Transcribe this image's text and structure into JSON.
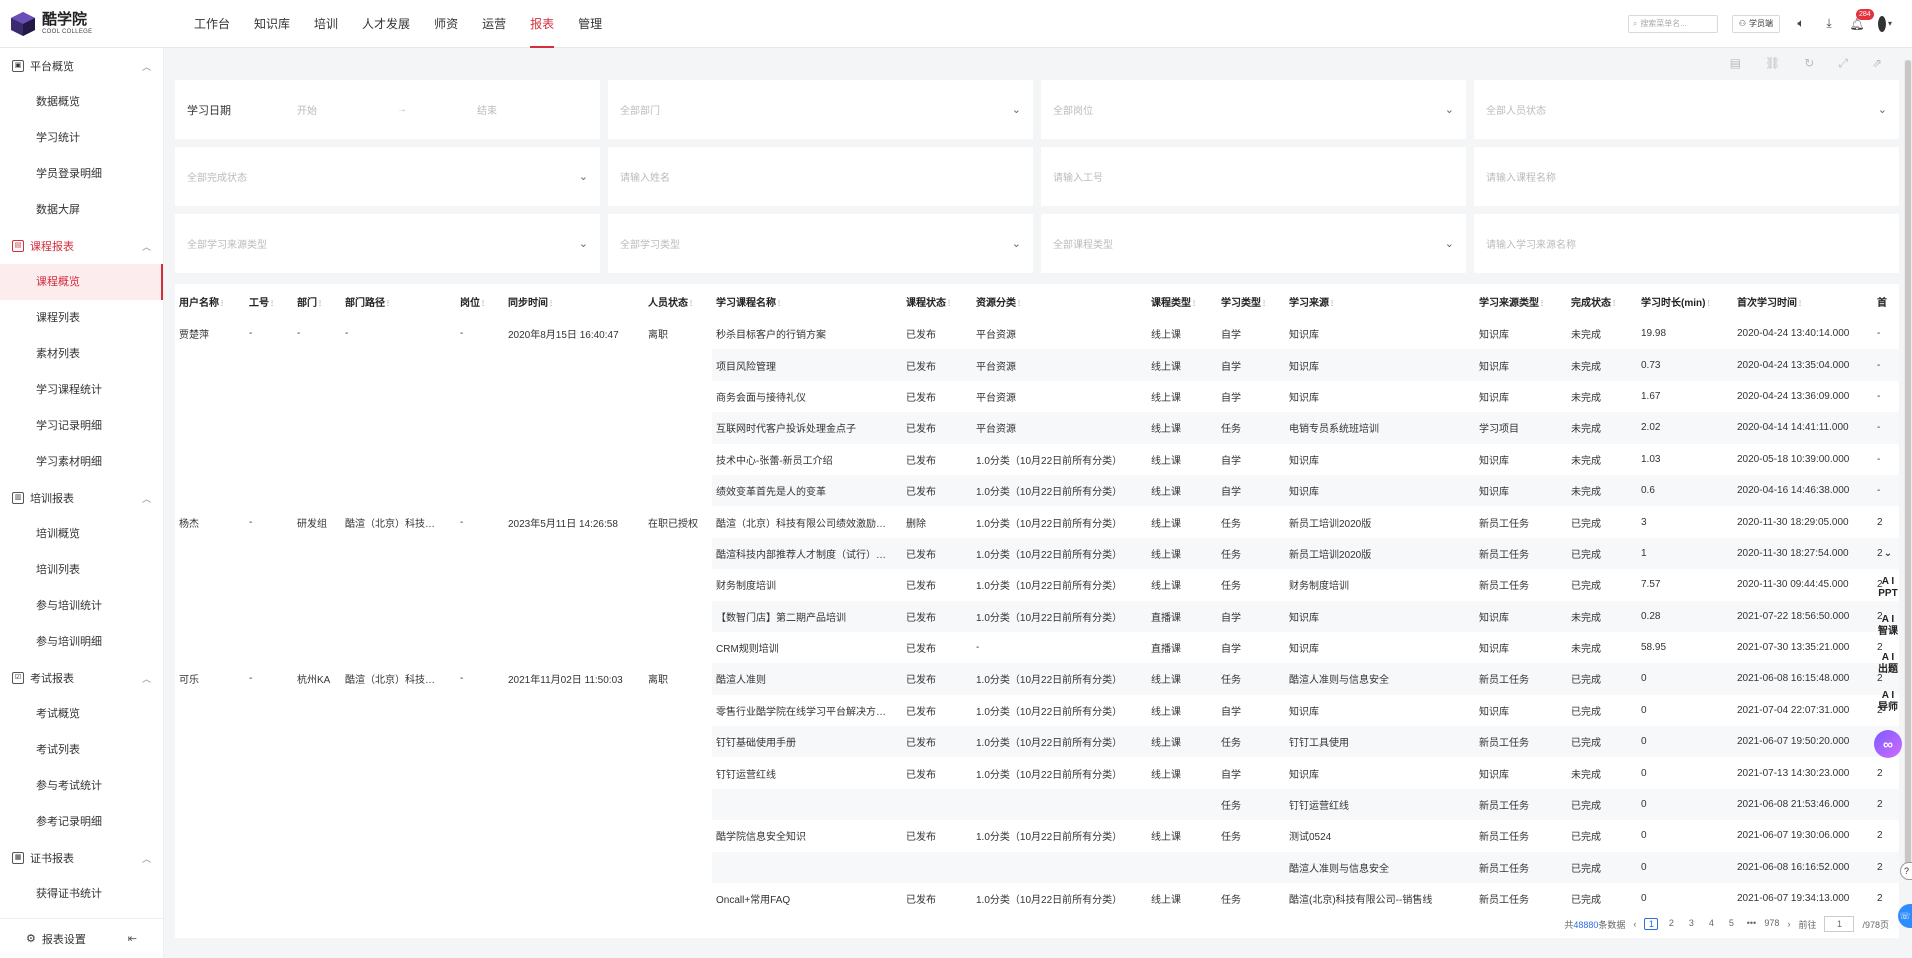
{
  "brand": {
    "name": "酷学院",
    "sub": "COOL COLLEGE",
    "accent": "#d22f3c"
  },
  "nav": [
    "工作台",
    "知识库",
    "培训",
    "人才发展",
    "师资",
    "运营",
    "报表",
    "管理"
  ],
  "nav_active": 6,
  "top": {
    "search_placeholder": "搜索菜单名...",
    "student_btn": "学员端",
    "notify_badge": "284"
  },
  "sidebar": {
    "groups": [
      {
        "title": "平台概览",
        "items": [
          "数据概览",
          "学习统计",
          "学员登录明细",
          "数据大屏"
        ]
      },
      {
        "title": "课程报表",
        "items": [
          "课程概览",
          "课程列表",
          "素材列表",
          "学习课程统计",
          "学习记录明细",
          "学习素材明细"
        ]
      },
      {
        "title": "培训报表",
        "items": [
          "培训概览",
          "培训列表",
          "参与培训统计",
          "参与培训明细"
        ]
      },
      {
        "title": "考试报表",
        "items": [
          "考试概览",
          "考试列表",
          "参与考试统计",
          "参考记录明细"
        ]
      },
      {
        "title": "证书报表",
        "items": [
          "获得证书统计"
        ]
      }
    ],
    "bottom": "报表设置"
  },
  "filters": {
    "date_label": "学习日期",
    "date_start": "开始",
    "date_arrow": "→",
    "date_end": "结束",
    "dept": "全部部门",
    "post": "全部岗位",
    "person_status": "全部人员状态",
    "complete_status": "全部完成状态",
    "name_ph": "请输入姓名",
    "id_ph": "请输入工号",
    "course_ph": "请输入课程名称",
    "source_type": "全部学习来源类型",
    "study_type": "全部学习类型",
    "course_type": "全部课程类型",
    "source_name_ph": "请输入学习来源名称"
  },
  "table": {
    "headers": [
      "用户名称",
      "工号",
      "部门",
      "部门路径",
      "岗位",
      "同步时间",
      "人员状态",
      "学习课程名称",
      "课程状态",
      "资源分类",
      "课程类型",
      "学习类型",
      "学习来源",
      "学习来源类型",
      "完成状态",
      "学习时长(min)",
      "首次学习时间",
      "首"
    ],
    "rows": [
      [
        "贾楚萍",
        "-",
        "-",
        "-",
        "-",
        "2020年8月15日 16:40:47",
        "离职",
        "秒杀目标客户的行销方案",
        "已发布",
        "平台资源",
        "线上课",
        "自学",
        "知识库",
        "知识库",
        "未完成",
        "19.98",
        "2020-04-24 13:40:14.000",
        "-"
      ],
      [
        "",
        "",
        "",
        "",
        "",
        "",
        "",
        "项目风险管理",
        "已发布",
        "平台资源",
        "线上课",
        "自学",
        "知识库",
        "知识库",
        "未完成",
        "0.73",
        "2020-04-24 13:35:04.000",
        "-"
      ],
      [
        "",
        "",
        "",
        "",
        "",
        "",
        "",
        "商务会面与接待礼仪",
        "已发布",
        "平台资源",
        "线上课",
        "自学",
        "知识库",
        "知识库",
        "未完成",
        "1.67",
        "2020-04-24 13:36:09.000",
        "-"
      ],
      [
        "",
        "",
        "",
        "",
        "",
        "",
        "",
        "互联网时代客户投诉处理金点子",
        "已发布",
        "平台资源",
        "线上课",
        "任务",
        "电销专员系统班培训",
        "学习项目",
        "未完成",
        "2.02",
        "2020-04-14 14:41:11.000",
        "-"
      ],
      [
        "",
        "",
        "",
        "",
        "",
        "",
        "",
        "技术中心-张蕾-新员工介绍",
        "已发布",
        "1.0分类（10月22日前所有分类）",
        "线上课",
        "自学",
        "知识库",
        "知识库",
        "未完成",
        "1.03",
        "2020-05-18 10:39:00.000",
        "-"
      ],
      [
        "",
        "",
        "",
        "",
        "",
        "",
        "",
        "绩效变革首先是人的变革",
        "已发布",
        "1.0分类（10月22日前所有分类）",
        "线上课",
        "自学",
        "知识库",
        "知识库",
        "未完成",
        "0.6",
        "2020-04-16 14:46:38.000",
        "-"
      ],
      [
        "杨杰",
        "-",
        "研发组",
        "酷渲（北京）科技…",
        "-",
        "2023年5月11日 14:26:58",
        "在职已授权",
        "酷渲（北京）科技有限公司绩效激励…",
        "删除",
        "1.0分类（10月22日前所有分类）",
        "线上课",
        "任务",
        "新员工培训2020版",
        "新员工任务",
        "已完成",
        "3",
        "2020-11-30 18:29:05.000",
        "2"
      ],
      [
        "",
        "",
        "",
        "",
        "",
        "",
        "",
        "酷渲科技内部推荐人才制度（试行）…",
        "已发布",
        "1.0分类（10月22日前所有分类）",
        "线上课",
        "任务",
        "新员工培训2020版",
        "新员工任务",
        "已完成",
        "1",
        "2020-11-30 18:27:54.000",
        "2"
      ],
      [
        "",
        "",
        "",
        "",
        "",
        "",
        "",
        "财务制度培训",
        "已发布",
        "1.0分类（10月22日前所有分类）",
        "线上课",
        "任务",
        "财务制度培训",
        "新员工任务",
        "已完成",
        "7.57",
        "2020-11-30 09:44:45.000",
        "2"
      ],
      [
        "",
        "",
        "",
        "",
        "",
        "",
        "",
        "【数智门店】第二期产品培训",
        "已发布",
        "1.0分类（10月22日前所有分类）",
        "直播课",
        "自学",
        "知识库",
        "知识库",
        "未完成",
        "0.28",
        "2021-07-22 18:56:50.000",
        "2"
      ],
      [
        "",
        "",
        "",
        "",
        "",
        "",
        "",
        "CRM规则培训",
        "已发布",
        "-",
        "直播课",
        "自学",
        "知识库",
        "知识库",
        "未完成",
        "58.95",
        "2021-07-30 13:35:21.000",
        "2"
      ],
      [
        "可乐",
        "-",
        "杭州KA",
        "酷渲（北京）科技…",
        "-",
        "2021年11月02日 11:50:03",
        "离职",
        "酷渲人准则",
        "已发布",
        "1.0分类（10月22日前所有分类）",
        "线上课",
        "任务",
        "酷渲人准则与信息安全",
        "新员工任务",
        "已完成",
        "0",
        "2021-06-08 16:15:48.000",
        "2"
      ],
      [
        "",
        "",
        "",
        "",
        "",
        "",
        "",
        "零售行业酷学院在线学习平台解决方…",
        "已发布",
        "1.0分类（10月22日前所有分类）",
        "线上课",
        "自学",
        "知识库",
        "知识库",
        "已完成",
        "0",
        "2021-07-04 22:07:31.000",
        "2"
      ],
      [
        "",
        "",
        "",
        "",
        "",
        "",
        "",
        "钉钉基础使用手册",
        "已发布",
        "1.0分类（10月22日前所有分类）",
        "线上课",
        "任务",
        "钉钉工具使用",
        "新员工任务",
        "已完成",
        "0",
        "2021-06-07 19:50:20.000",
        "2"
      ],
      [
        "",
        "",
        "",
        "",
        "",
        "",
        "",
        "钉钉运营红线",
        "已发布",
        "1.0分类（10月22日前所有分类）",
        "线上课",
        "自学",
        "知识库",
        "知识库",
        "未完成",
        "0",
        "2021-07-13 14:30:23.000",
        "2"
      ],
      [
        "",
        "",
        "",
        "",
        "",
        "",
        "",
        "",
        "",
        "",
        "",
        "任务",
        "钉钉运营红线",
        "新员工任务",
        "已完成",
        "0",
        "2021-06-08 21:53:46.000",
        "2"
      ],
      [
        "",
        "",
        "",
        "",
        "",
        "",
        "",
        "酷学院信息安全知识",
        "已发布",
        "1.0分类（10月22日前所有分类）",
        "线上课",
        "任务",
        "测试0524",
        "新员工任务",
        "已完成",
        "0",
        "2021-06-07 19:30:06.000",
        "2"
      ],
      [
        "",
        "",
        "",
        "",
        "",
        "",
        "",
        "",
        "",
        "",
        "",
        "",
        "酷渲人准则与信息安全",
        "新员工任务",
        "已完成",
        "0",
        "2021-06-08 16:16:52.000",
        "2"
      ],
      [
        "",
        "",
        "",
        "",
        "",
        "",
        "",
        "Oncall+常用FAQ",
        "已发布",
        "1.0分类（10月22日前所有分类）",
        "线上课",
        "任务",
        "酷渲(北京)科技有限公司--销售线",
        "新员工任务",
        "已完成",
        "0",
        "2021-06-07 19:34:13.000",
        "2"
      ]
    ]
  },
  "pager": {
    "prefix": "共",
    "total": "48880",
    "suffix": "条数据",
    "pages": [
      "1",
      "2",
      "3",
      "4",
      "5",
      "•••",
      "978"
    ],
    "goto": "前往",
    "current": "1",
    "total_pages": "/978页"
  },
  "ai": {
    "items": [
      "A I PPT",
      "A I 智课",
      "A I 出题",
      "A I 导师"
    ]
  }
}
